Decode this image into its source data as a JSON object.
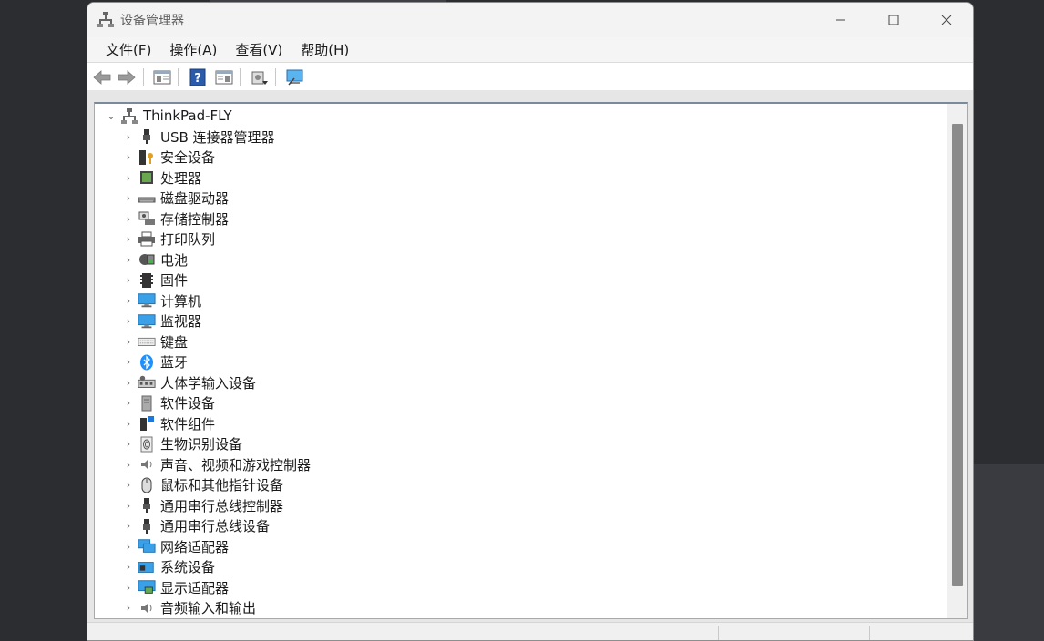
{
  "window": {
    "title": "设备管理器"
  },
  "menu": [
    {
      "label": "文件(F)",
      "name": "menu-file"
    },
    {
      "label": "操作(A)",
      "name": "menu-action"
    },
    {
      "label": "查看(V)",
      "name": "menu-view"
    },
    {
      "label": "帮助(H)",
      "name": "menu-help"
    }
  ],
  "toolbar": {
    "buttons": [
      "back-icon",
      "forward-icon",
      "properties-pane-icon",
      "help-icon",
      "show-hide-pane-icon",
      "update-driver-icon",
      "scan-hardware-icon"
    ]
  },
  "tree": {
    "root": "ThinkPad-FLY",
    "items": [
      {
        "label": "USB 连接器管理器",
        "icon": "usb-icon"
      },
      {
        "label": "安全设备",
        "icon": "security-device-icon"
      },
      {
        "label": "处理器",
        "icon": "processor-icon"
      },
      {
        "label": "磁盘驱动器",
        "icon": "disk-drive-icon"
      },
      {
        "label": "存储控制器",
        "icon": "storage-controller-icon"
      },
      {
        "label": "打印队列",
        "icon": "printer-icon"
      },
      {
        "label": "电池",
        "icon": "battery-icon"
      },
      {
        "label": "固件",
        "icon": "firmware-icon"
      },
      {
        "label": "计算机",
        "icon": "computer-icon"
      },
      {
        "label": "监视器",
        "icon": "monitor-icon"
      },
      {
        "label": "键盘",
        "icon": "keyboard-icon"
      },
      {
        "label": "蓝牙",
        "icon": "bluetooth-icon"
      },
      {
        "label": "人体学输入设备",
        "icon": "hid-icon"
      },
      {
        "label": "软件设备",
        "icon": "software-device-icon"
      },
      {
        "label": "软件组件",
        "icon": "software-component-icon"
      },
      {
        "label": "生物识别设备",
        "icon": "biometric-icon"
      },
      {
        "label": "声音、视频和游戏控制器",
        "icon": "sound-icon"
      },
      {
        "label": "鼠标和其他指针设备",
        "icon": "mouse-icon"
      },
      {
        "label": "通用串行总线控制器",
        "icon": "usb-controller-icon"
      },
      {
        "label": "通用串行总线设备",
        "icon": "usb-device-icon"
      },
      {
        "label": "网络适配器",
        "icon": "network-adapter-icon"
      },
      {
        "label": "系统设备",
        "icon": "system-device-icon"
      },
      {
        "label": "显示适配器",
        "icon": "display-adapter-icon"
      },
      {
        "label": "音频输入和输出",
        "icon": "audio-io-icon"
      }
    ]
  },
  "colors": {
    "accent": "#1e78d7",
    "monitor": "#3aa0e8",
    "bluetooth": "#1e90ff"
  }
}
